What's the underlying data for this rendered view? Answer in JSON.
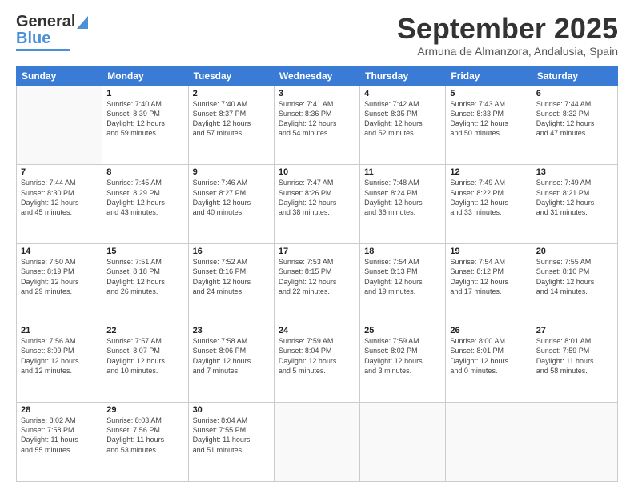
{
  "logo": {
    "line1": "General",
    "line2": "Blue"
  },
  "title": "September 2025",
  "location": "Armuna de Almanzora, Andalusia, Spain",
  "weekdays": [
    "Sunday",
    "Monday",
    "Tuesday",
    "Wednesday",
    "Thursday",
    "Friday",
    "Saturday"
  ],
  "weeks": [
    [
      {
        "day": "",
        "info": ""
      },
      {
        "day": "1",
        "info": "Sunrise: 7:40 AM\nSunset: 8:39 PM\nDaylight: 12 hours\nand 59 minutes."
      },
      {
        "day": "2",
        "info": "Sunrise: 7:40 AM\nSunset: 8:37 PM\nDaylight: 12 hours\nand 57 minutes."
      },
      {
        "day": "3",
        "info": "Sunrise: 7:41 AM\nSunset: 8:36 PM\nDaylight: 12 hours\nand 54 minutes."
      },
      {
        "day": "4",
        "info": "Sunrise: 7:42 AM\nSunset: 8:35 PM\nDaylight: 12 hours\nand 52 minutes."
      },
      {
        "day": "5",
        "info": "Sunrise: 7:43 AM\nSunset: 8:33 PM\nDaylight: 12 hours\nand 50 minutes."
      },
      {
        "day": "6",
        "info": "Sunrise: 7:44 AM\nSunset: 8:32 PM\nDaylight: 12 hours\nand 47 minutes."
      }
    ],
    [
      {
        "day": "7",
        "info": "Sunrise: 7:44 AM\nSunset: 8:30 PM\nDaylight: 12 hours\nand 45 minutes."
      },
      {
        "day": "8",
        "info": "Sunrise: 7:45 AM\nSunset: 8:29 PM\nDaylight: 12 hours\nand 43 minutes."
      },
      {
        "day": "9",
        "info": "Sunrise: 7:46 AM\nSunset: 8:27 PM\nDaylight: 12 hours\nand 40 minutes."
      },
      {
        "day": "10",
        "info": "Sunrise: 7:47 AM\nSunset: 8:26 PM\nDaylight: 12 hours\nand 38 minutes."
      },
      {
        "day": "11",
        "info": "Sunrise: 7:48 AM\nSunset: 8:24 PM\nDaylight: 12 hours\nand 36 minutes."
      },
      {
        "day": "12",
        "info": "Sunrise: 7:49 AM\nSunset: 8:22 PM\nDaylight: 12 hours\nand 33 minutes."
      },
      {
        "day": "13",
        "info": "Sunrise: 7:49 AM\nSunset: 8:21 PM\nDaylight: 12 hours\nand 31 minutes."
      }
    ],
    [
      {
        "day": "14",
        "info": "Sunrise: 7:50 AM\nSunset: 8:19 PM\nDaylight: 12 hours\nand 29 minutes."
      },
      {
        "day": "15",
        "info": "Sunrise: 7:51 AM\nSunset: 8:18 PM\nDaylight: 12 hours\nand 26 minutes."
      },
      {
        "day": "16",
        "info": "Sunrise: 7:52 AM\nSunset: 8:16 PM\nDaylight: 12 hours\nand 24 minutes."
      },
      {
        "day": "17",
        "info": "Sunrise: 7:53 AM\nSunset: 8:15 PM\nDaylight: 12 hours\nand 22 minutes."
      },
      {
        "day": "18",
        "info": "Sunrise: 7:54 AM\nSunset: 8:13 PM\nDaylight: 12 hours\nand 19 minutes."
      },
      {
        "day": "19",
        "info": "Sunrise: 7:54 AM\nSunset: 8:12 PM\nDaylight: 12 hours\nand 17 minutes."
      },
      {
        "day": "20",
        "info": "Sunrise: 7:55 AM\nSunset: 8:10 PM\nDaylight: 12 hours\nand 14 minutes."
      }
    ],
    [
      {
        "day": "21",
        "info": "Sunrise: 7:56 AM\nSunset: 8:09 PM\nDaylight: 12 hours\nand 12 minutes."
      },
      {
        "day": "22",
        "info": "Sunrise: 7:57 AM\nSunset: 8:07 PM\nDaylight: 12 hours\nand 10 minutes."
      },
      {
        "day": "23",
        "info": "Sunrise: 7:58 AM\nSunset: 8:06 PM\nDaylight: 12 hours\nand 7 minutes."
      },
      {
        "day": "24",
        "info": "Sunrise: 7:59 AM\nSunset: 8:04 PM\nDaylight: 12 hours\nand 5 minutes."
      },
      {
        "day": "25",
        "info": "Sunrise: 7:59 AM\nSunset: 8:02 PM\nDaylight: 12 hours\nand 3 minutes."
      },
      {
        "day": "26",
        "info": "Sunrise: 8:00 AM\nSunset: 8:01 PM\nDaylight: 12 hours\nand 0 minutes."
      },
      {
        "day": "27",
        "info": "Sunrise: 8:01 AM\nSunset: 7:59 PM\nDaylight: 11 hours\nand 58 minutes."
      }
    ],
    [
      {
        "day": "28",
        "info": "Sunrise: 8:02 AM\nSunset: 7:58 PM\nDaylight: 11 hours\nand 55 minutes."
      },
      {
        "day": "29",
        "info": "Sunrise: 8:03 AM\nSunset: 7:56 PM\nDaylight: 11 hours\nand 53 minutes."
      },
      {
        "day": "30",
        "info": "Sunrise: 8:04 AM\nSunset: 7:55 PM\nDaylight: 11 hours\nand 51 minutes."
      },
      {
        "day": "",
        "info": ""
      },
      {
        "day": "",
        "info": ""
      },
      {
        "day": "",
        "info": ""
      },
      {
        "day": "",
        "info": ""
      }
    ]
  ]
}
